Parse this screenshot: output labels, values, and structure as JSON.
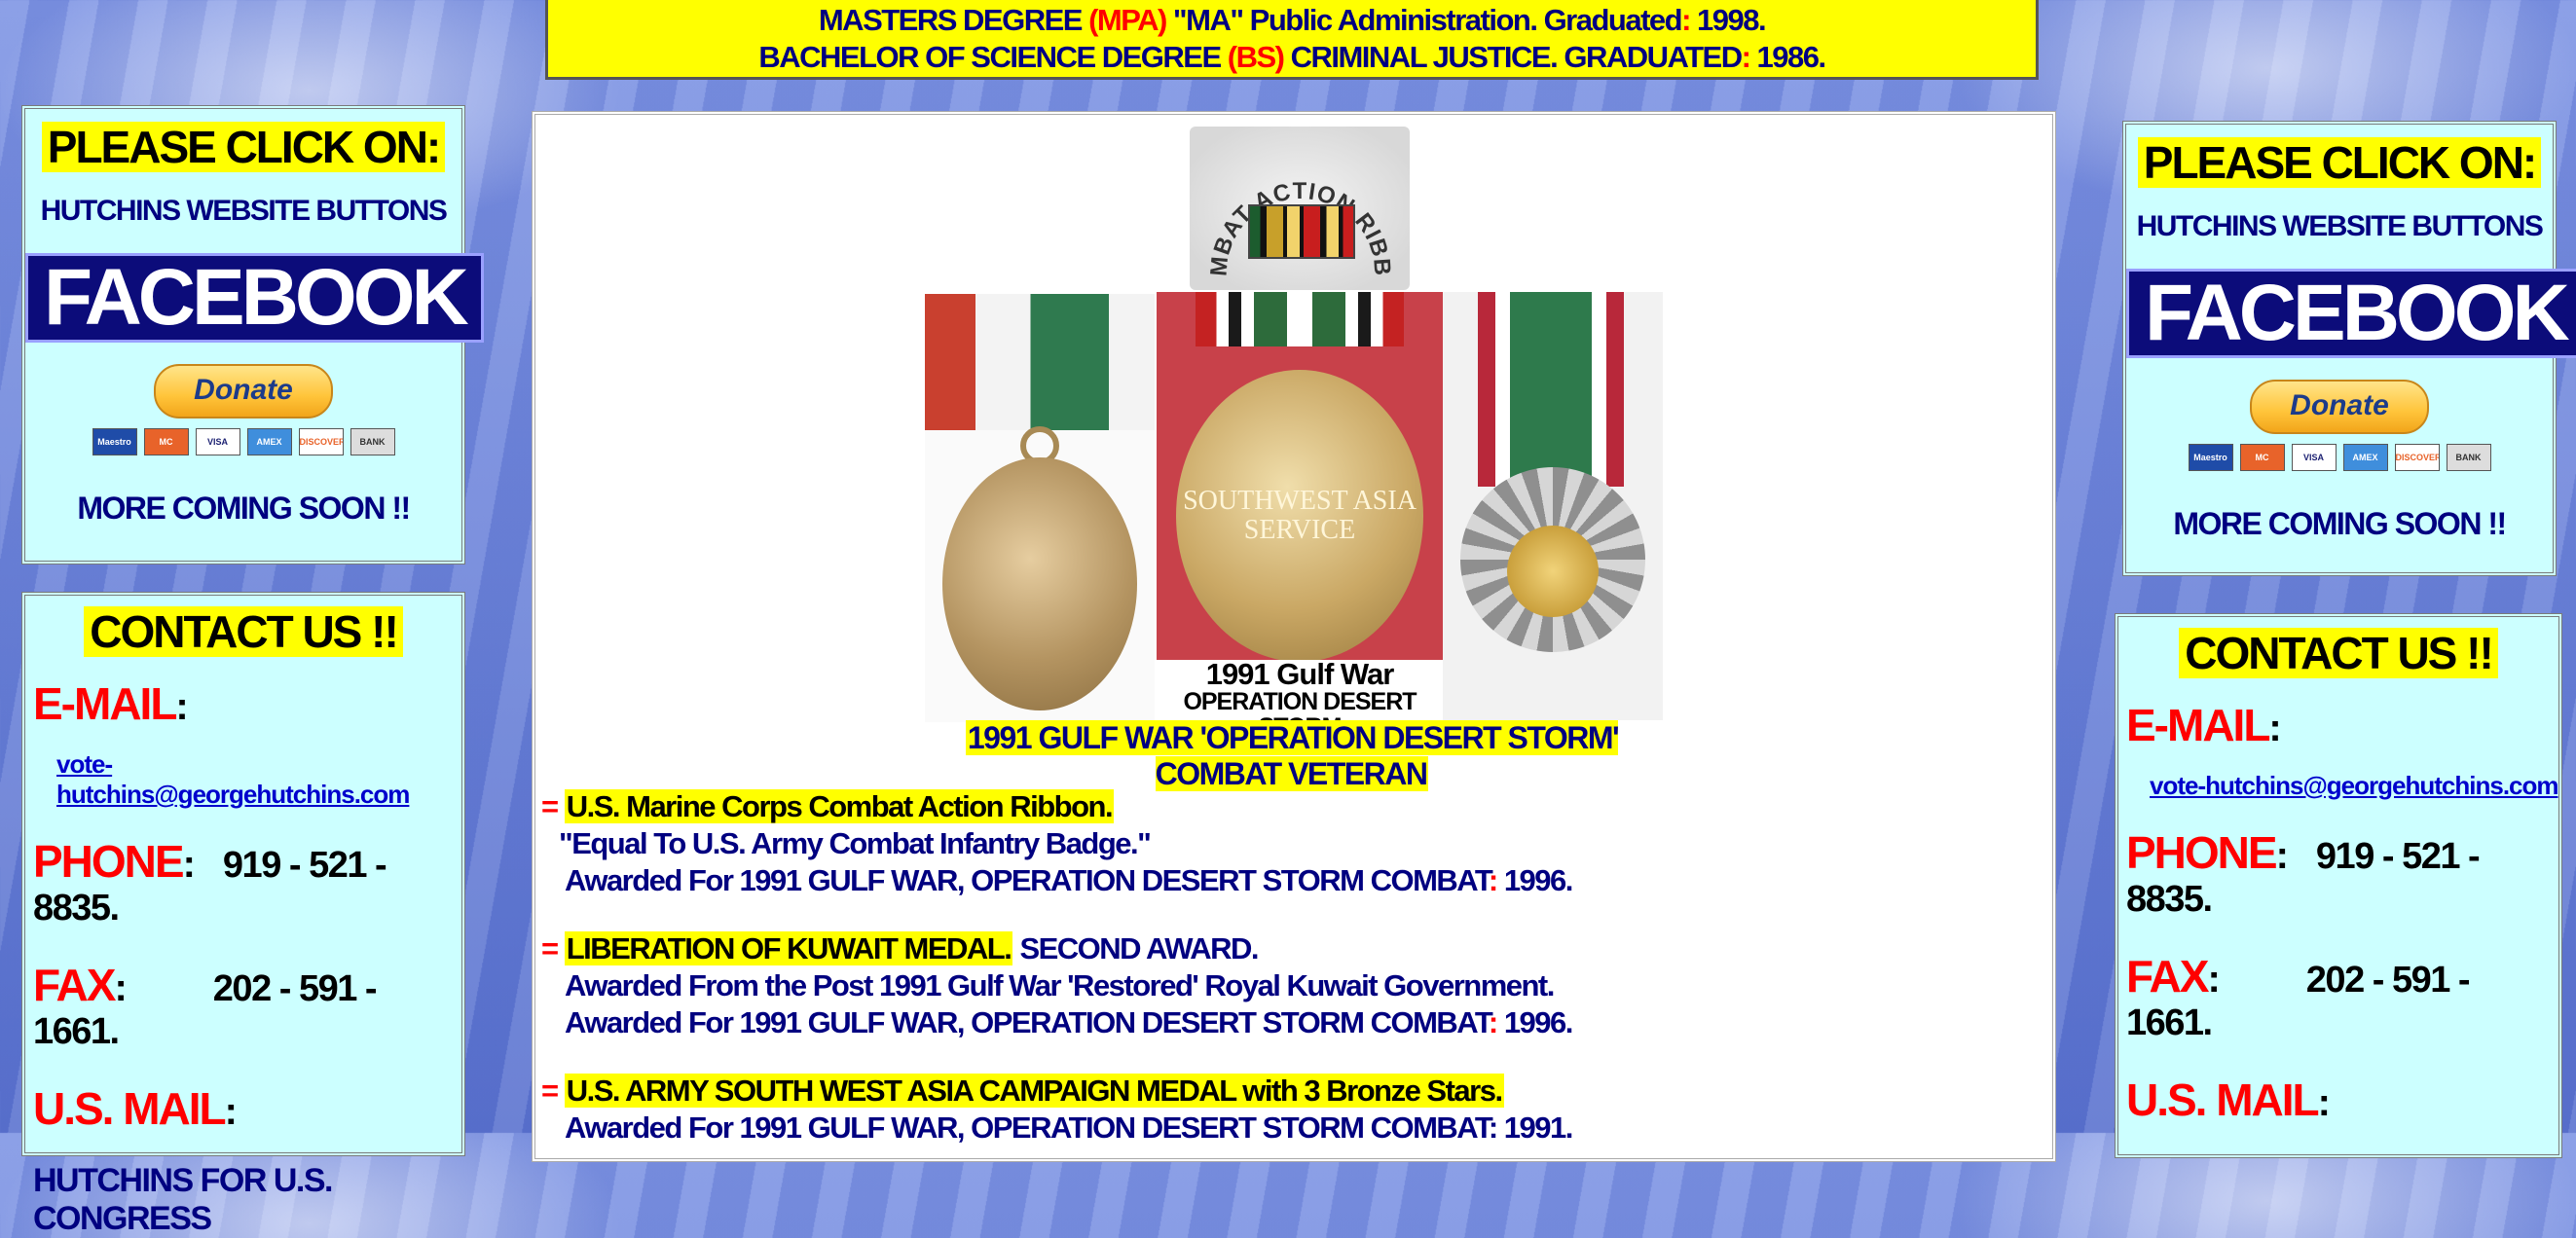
{
  "degrees": {
    "line1": {
      "prefix": "MASTERS DEGREE ",
      "paren": "(MPA)",
      "mid": " \"MA\" Public Administration. Graduated",
      "colon": ":",
      "year": " 1998."
    },
    "line2": {
      "prefix": "BACHELOR OF SCIENCE DEGREE ",
      "paren": "(BS)",
      "mid": " CRIMINAL JUSTICE. GRADUATED",
      "colon": ":",
      "year": " 1986."
    }
  },
  "sidebar": {
    "click_title": "PLEASE  CLICK ON:",
    "buttons_label": "HUTCHINS WEBSITE BUTTONS",
    "facebook_label": "FACEBOOK",
    "donate_label": "Donate",
    "payment_cards": [
      "Maestro",
      "MC",
      "VISA",
      "AMEX",
      "DISCOVER",
      "BANK"
    ],
    "more_label": "MORE COMING SOON !!",
    "contact_title": "CONTACT US !!",
    "email_label": "E-MAIL",
    "email_value": "vote-hutchins@georgehutchins.com",
    "phone_label": "PHONE",
    "phone_value": "919 - 521 - 8835.",
    "fax_label": "FAX",
    "fax_value": "202 - 591 - 1661.",
    "mail_label": "U.S. MAIL",
    "mail_line1": "HUTCHINS FOR U.S. CONGRESS",
    "colon": ":"
  },
  "medals": {
    "combat_ribbon_text": "COMBAT ACTION RIBBON",
    "center_coin_text": [
      "SOUTHWEST ASIA",
      "SERVICE"
    ],
    "center_caption_line1": "1991 Gulf War",
    "center_caption_line2": "OPERATION DESERT STORM",
    "caption": "1991 GULF WAR 'OPERATION DESERT STORM'  COMBAT  VETERAN"
  },
  "awards": [
    {
      "eq": "= ",
      "name": "U.S. Marine Corps Combat  Action Ribbon.",
      "extra": "",
      "line2": "\"Equal To U.S.  Army Combat Infantry Badge.\"",
      "line3_text": "Awarded For 1991 GULF WAR, OPERATION DESERT STORM COMBAT",
      "line3_year": "  1996."
    },
    {
      "eq": "= ",
      "name": "LIBERATION OF KUWAIT MEDAL.",
      "extra": "  SECOND AWARD.",
      "line2": "Awarded From the Post 1991 Gulf War 'Restored' Royal Kuwait Government.",
      "line3_text": "Awarded For 1991 GULF WAR, OPERATION DESERT STORM COMBAT",
      "line3_year": "  1996."
    },
    {
      "eq": "= ",
      "name": "U.S.  ARMY SOUTH WEST ASIA CAMPAIGN MEDAL with 3 Bronze Stars.",
      "extra": "",
      "line2": "Awarded For 1991 GULF WAR, OPERATION DESERT STORM COMBAT:  1991.",
      "line3_text": "",
      "line3_year": ""
    }
  ],
  "colon": ":"
}
